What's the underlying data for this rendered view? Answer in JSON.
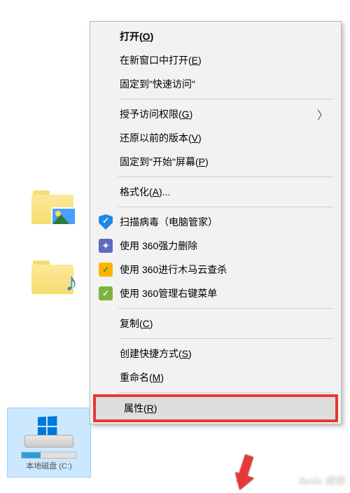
{
  "desktop": {
    "drive_label": "本地磁盘 (C:)"
  },
  "menu": {
    "open": "打开(",
    "open_key": "O",
    "open_end": ")",
    "open_new": "在新窗口中打开(",
    "open_new_key": "E",
    "open_new_end": ")",
    "pin_quick": "固定到\"快速访问\"",
    "grant": "授予访问权限(",
    "grant_key": "G",
    "grant_end": ")",
    "restore": "还原以前的版本(",
    "restore_key": "V",
    "restore_end": ")",
    "pin_start": "固定到\"开始\"屏幕(",
    "pin_start_key": "P",
    "pin_start_end": ")",
    "format": "格式化(",
    "format_key": "A",
    "format_end": ")...",
    "scan_virus": "扫描病毒（电脑管家）",
    "force_delete": "使用 360强力删除",
    "trojan_scan": "使用 360进行木马云查杀",
    "manage_menu": "使用 360管理右键菜单",
    "copy": "复制(",
    "copy_key": "C",
    "copy_end": ")",
    "shortcut": "创建快捷方式(",
    "shortcut_key": "S",
    "shortcut_end": ")",
    "rename": "重命名(",
    "rename_key": "M",
    "rename_end": ")",
    "properties": "属性(",
    "properties_key": "R",
    "properties_end": ")"
  },
  "watermark": "Baidu 经验"
}
